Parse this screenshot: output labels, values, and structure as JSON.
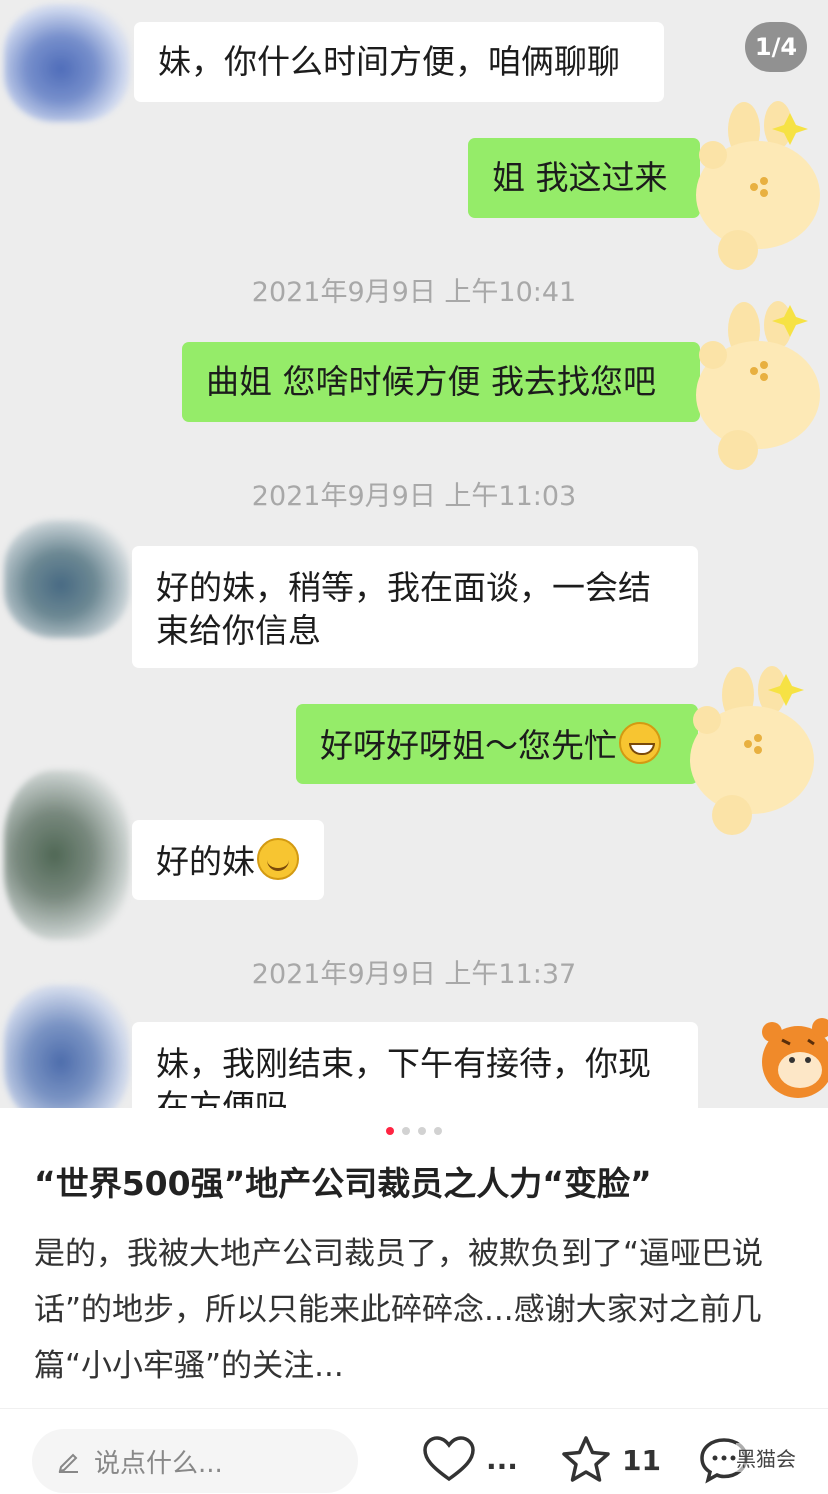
{
  "counter": "1/4",
  "messages": [
    {
      "text": "妹，你什么时间方便，咱俩聊聊"
    },
    {
      "text": "姐 我这过来"
    },
    {
      "time": "2021年9月9日 上午10:41"
    },
    {
      "text": "曲姐 您啥时候方便 我去找您吧"
    },
    {
      "time": "2021年9月9日 上午11:03"
    },
    {
      "text": "好的妹，稍等，我在面谈，一会结束给你信息"
    },
    {
      "text": "好呀好呀姐～您先忙"
    },
    {
      "text": "好的妹"
    },
    {
      "time": "2021年9月9日 上午11:37"
    },
    {
      "text": "妹，我刚结束，下午有接待，你现在方便吗"
    }
  ],
  "post": {
    "title": "“世界500强”地产公司裁员之人力“变脸”",
    "body": "是的，我被大地产公司裁员了，被欺负到了“逼哑巴说话”的地步，所以只能来此碎碎念...感谢大家对之前几篇“小小牢骚”的关注..."
  },
  "bottom_bar": {
    "comment_placeholder": "说点什么...",
    "like_count": "...",
    "collect_count": "11",
    "watermark": "黑猫会"
  }
}
